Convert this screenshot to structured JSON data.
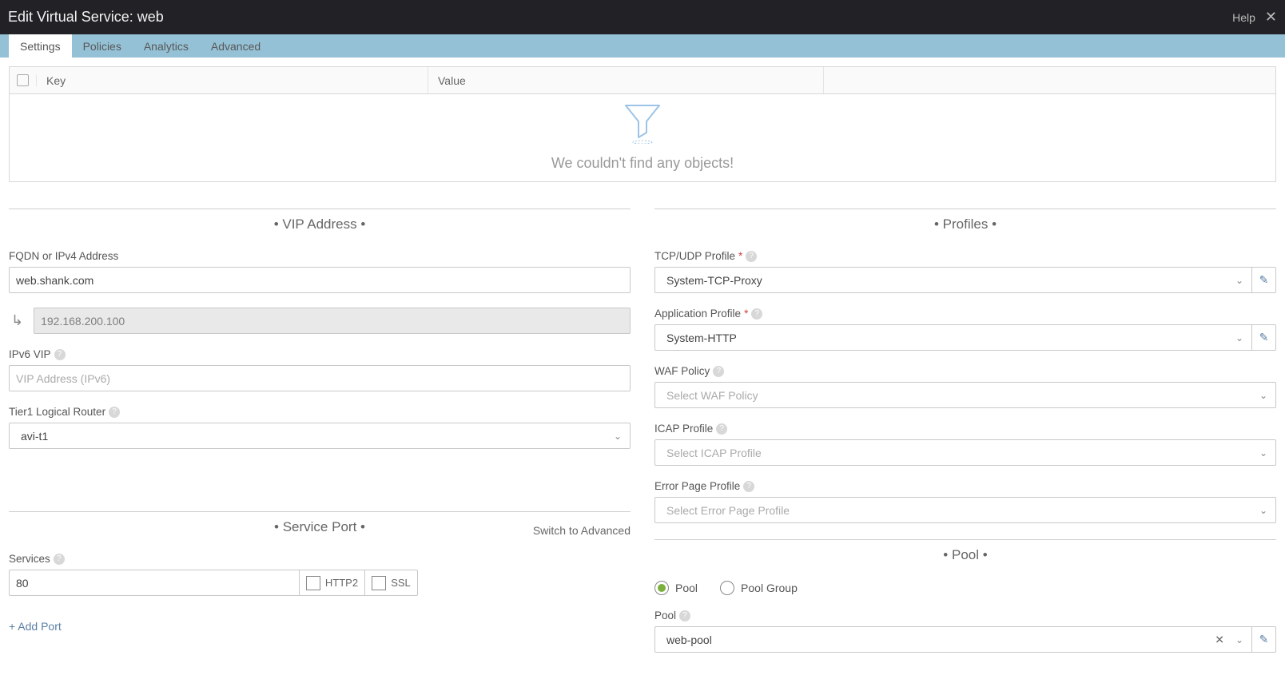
{
  "header": {
    "title": "Edit Virtual Service: web",
    "help": "Help"
  },
  "tabs": [
    "Settings",
    "Policies",
    "Analytics",
    "Advanced"
  ],
  "table": {
    "key_header": "Key",
    "value_header": "Value",
    "empty_message": "We couldn't find any objects!"
  },
  "sections": {
    "vip_address": "VIP Address",
    "service_port": "Service Port",
    "profiles": "Profiles",
    "pool": "Pool"
  },
  "left": {
    "fqdn_label": "FQDN or IPv4 Address",
    "fqdn_value": "web.shank.com",
    "ip_value": "192.168.200.100",
    "ipv6_label": "IPv6 VIP",
    "ipv6_placeholder": "VIP Address (IPv6)",
    "tier1_label": "Tier1 Logical Router",
    "tier1_value": "avi-t1",
    "switch_link": "Switch to Advanced",
    "services_label": "Services",
    "services_value": "80",
    "http2_label": "HTTP2",
    "ssl_label": "SSL",
    "add_port": "+ Add Port"
  },
  "right": {
    "tcp_label": "TCP/UDP Profile",
    "tcp_value": "System-TCP-Proxy",
    "app_label": "Application Profile",
    "app_value": "System-HTTP",
    "waf_label": "WAF Policy",
    "waf_placeholder": "Select WAF Policy",
    "icap_label": "ICAP Profile",
    "icap_placeholder": "Select ICAP Profile",
    "error_label": "Error Page Profile",
    "error_placeholder": "Select Error Page Profile",
    "pool_radio": "Pool",
    "poolgroup_radio": "Pool Group",
    "pool_label": "Pool",
    "pool_value": "web-pool"
  }
}
